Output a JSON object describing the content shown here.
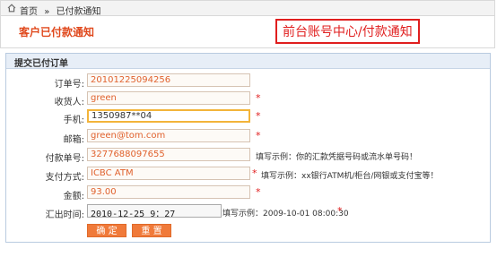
{
  "breadcrumb": {
    "home": "首页",
    "separator": "»",
    "current": "已付款通知"
  },
  "header": {
    "title": "客户已付款通知",
    "callout": "前台账号中心/付款通知"
  },
  "form": {
    "title": "提交已付订单",
    "fields": [
      {
        "label": "订单号:",
        "value": "20101225094256",
        "required": false,
        "hint": ""
      },
      {
        "label": "收货人:",
        "value": "green",
        "required": true,
        "hint": ""
      },
      {
        "label": "手机:",
        "value": "1350987**04",
        "required": true,
        "hint": ""
      },
      {
        "label": "邮箱:",
        "value": "green@tom.com",
        "required": true,
        "hint": ""
      },
      {
        "label": "付款单号:",
        "value": "3277688097655",
        "required": false,
        "hint": "填写示例：你的汇款凭据号码或流水单号码！"
      },
      {
        "label": "支付方式:",
        "value": "ICBC ATM",
        "required": true,
        "hint": "填写示例：xx银行ATM机/柜台/网银或支付宝等！"
      },
      {
        "label": "金额:",
        "value": "93.00",
        "required": true,
        "hint": ""
      },
      {
        "label": "汇出时间:",
        "value": "2010-12-25  9：27",
        "required": true,
        "hint": "填写示例：2009-10-01 08:00:30"
      }
    ],
    "buttons": {
      "confirm": "确 定",
      "reset": "重 置"
    }
  }
}
